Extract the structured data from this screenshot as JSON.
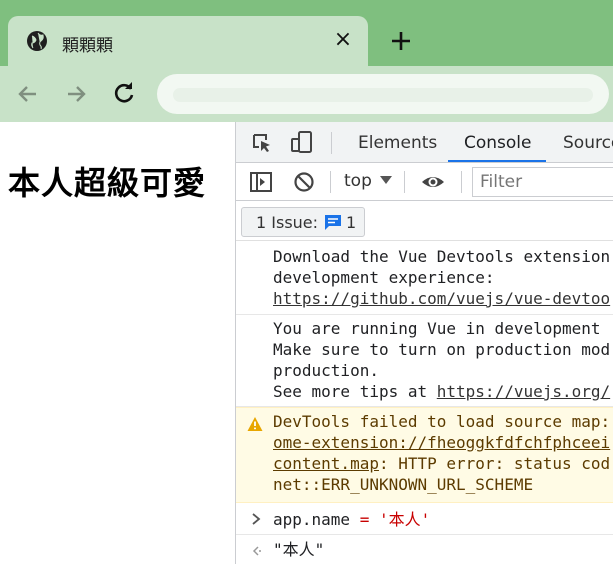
{
  "browser": {
    "tab": {
      "title": "顆顆顆",
      "close_symbol": "×"
    },
    "new_tab_symbol": "+"
  },
  "page": {
    "heading": "本人超級可愛"
  },
  "devtools": {
    "tabs": [
      "Elements",
      "Console",
      "Source"
    ],
    "active_tab": "Console",
    "accent_color": "#1a73e8",
    "context": "top",
    "filter_placeholder": "Filter",
    "issues": {
      "label": "1 Issue:",
      "count": "1"
    },
    "console": {
      "messages": [
        {
          "line1": "Download the Vue Devtools extension",
          "line2": "development experience:",
          "link": "https://github.com/vuejs/vue-devtoo"
        },
        {
          "line1": "You are running Vue in development",
          "line2": "Make sure to turn on production mod",
          "line3": "production.",
          "line4_prefix": "See more tips at ",
          "line4_link": "https://vuejs.org/"
        },
        {
          "level": "warning",
          "line1": "DevTools failed to load source map:",
          "line2_link": "ome-extension://fheoggkfdfchfphceei",
          "line3_link": "content.map",
          "line3_rest": ": HTTP error: status cod",
          "line4": "net::ERR_UNKNOWN_URL_SCHEME"
        }
      ],
      "input": {
        "expr": "app.name",
        "op": " = ",
        "value": "'本人'"
      },
      "result": "\"本人\""
    }
  }
}
